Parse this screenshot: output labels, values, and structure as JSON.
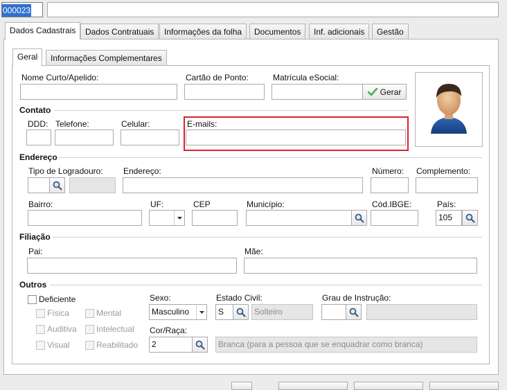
{
  "header": {
    "code_value": "000023",
    "name_value": ""
  },
  "tabs": [
    {
      "label": "Dados Cadastrais"
    },
    {
      "label": "Dados Contratuais"
    },
    {
      "label": "Informações da folha"
    },
    {
      "label": "Documentos"
    },
    {
      "label": "Inf. adicionais"
    },
    {
      "label": "Gestão"
    }
  ],
  "subtabs": [
    {
      "label": "Geral"
    },
    {
      "label": "Informações Complementares"
    }
  ],
  "identification": {
    "nome_curto_label": "Nome Curto/Apelido:",
    "cartao_ponto_label": "Cartão de Ponto:",
    "matricula_label": "Matrícula eSocial:",
    "gerar_label": "Gerar"
  },
  "contato": {
    "title": "Contato",
    "ddd_label": "DDD:",
    "telefone_label": "Telefone:",
    "celular_label": "Celular:",
    "emails_label": "E-mails:"
  },
  "endereco": {
    "title": "Endereço",
    "tipo_logradouro_label": "Tipo de Logradouro:",
    "endereco_label": "Endereço:",
    "numero_label": "Número:",
    "complemento_label": "Complemento:",
    "bairro_label": "Bairro:",
    "uf_label": "UF:",
    "cep_label": "CEP",
    "municipio_label": "Município:",
    "cod_ibge_label": "Cód.IBGE:",
    "pais_label": "País:",
    "pais_value": "105"
  },
  "filiacao": {
    "title": "Filiação",
    "pai_label": "Pai:",
    "mae_label": "Mãe:"
  },
  "outros": {
    "title": "Outros",
    "deficiente_label": "Deficiente",
    "fisica_label": "Física",
    "mental_label": "Mental",
    "auditiva_label": "Auditiva",
    "intelectual_label": "Intelectual",
    "visual_label": "Visual",
    "reabilitado_label": "Reabilitado",
    "sexo_label": "Sexo:",
    "sexo_value": "Masculino",
    "estado_civil_label": "Estado Civil:",
    "estado_civil_code": "S",
    "estado_civil_desc": "Solteiro",
    "grau_instrucao_label": "Grau de Instrução:",
    "cor_raca_label": "Cor/Raça:",
    "cor_raca_code": "2",
    "cor_raca_desc": "Branca (para a pessoa que se enquadrar como branca)"
  },
  "colors": {
    "highlight": "#d9232d",
    "selection": "#3070d0",
    "check": "#4caf50"
  }
}
